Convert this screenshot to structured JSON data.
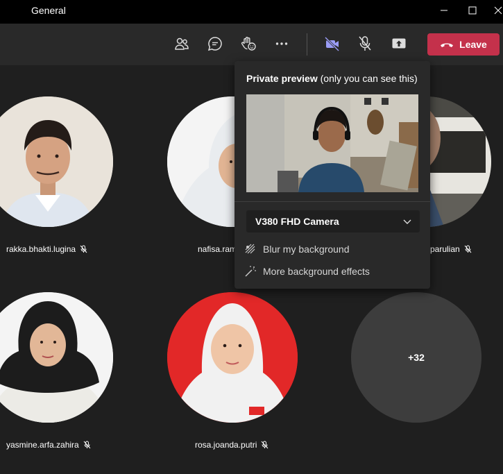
{
  "window": {
    "title": "General"
  },
  "toolbar": {
    "leave_label": "Leave"
  },
  "participants": [
    {
      "name": "rakka.bhakti.lugina"
    },
    {
      "name": "nafisa.ram"
    },
    {
      "name": "parulian"
    },
    {
      "name": "yasmine.arfa.zahira"
    },
    {
      "name": "rosa.joanda.putri"
    }
  ],
  "overflow": {
    "count_label": "+32"
  },
  "preview": {
    "title_bold": "Private preview",
    "title_rest": " (only you can see this)",
    "camera_label": "V380 FHD Camera",
    "options": [
      "Blur my background",
      "More background effects"
    ]
  },
  "colors": {
    "leave": "#c4314b",
    "camera_active": "#9a9cf5",
    "background": "#1f1f1f",
    "toolbar": "#292929"
  }
}
